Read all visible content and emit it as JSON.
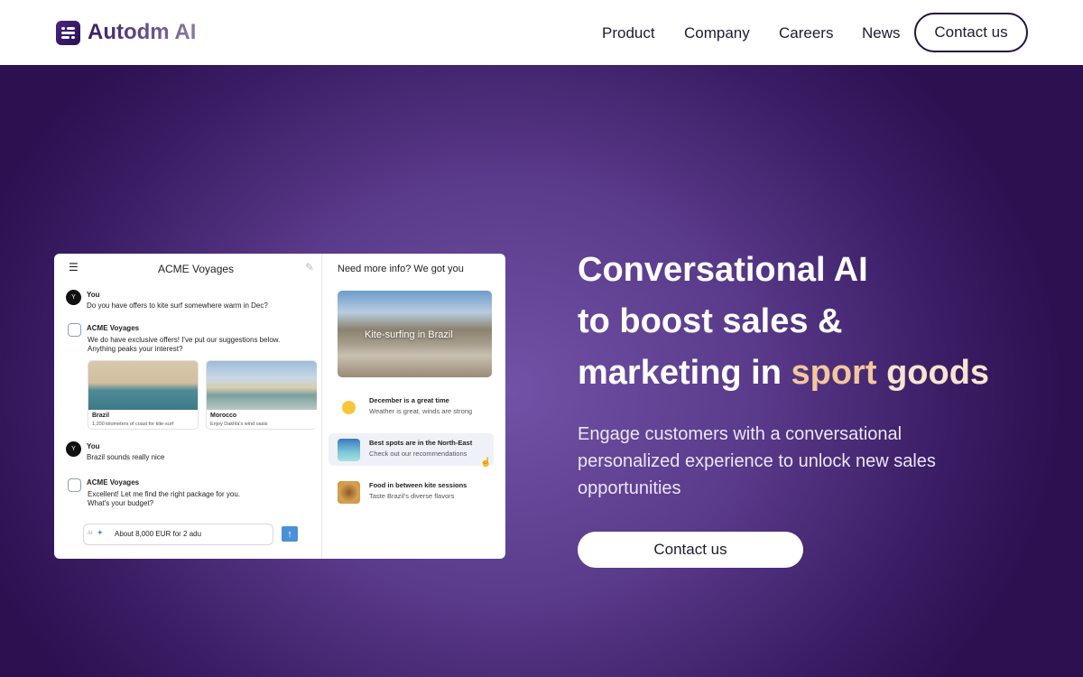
{
  "header": {
    "logo": "Autodm AI",
    "nav": [
      "Product",
      "Company",
      "Careers",
      "News"
    ],
    "contact": "Contact us"
  },
  "chat": {
    "title": "ACME Voyages",
    "messages": [
      {
        "sender": "You",
        "avatar": "Y",
        "text": "Do you have offers to kite surf somewhere warm in Dec?"
      },
      {
        "sender": "ACME Voyages",
        "lines": [
          "We do have exclusive offers! I've put our suggestions below.",
          "Anything peaks your interest?"
        ]
      },
      {
        "sender": "You",
        "avatar": "Y",
        "text": "Brazil sounds really nice"
      },
      {
        "sender": "ACME Voyages",
        "lines": [
          "Excellent! Let me find the right package for you.",
          "What's your budget?"
        ]
      }
    ],
    "offers": [
      {
        "title": "Brazil",
        "subtitle": "1,200 kilometers of coast for kite-surf"
      },
      {
        "title": "Morocco",
        "subtitle": "Enjoy Dakhla's wind oasis"
      }
    ],
    "input": {
      "prefix": "AI",
      "value": "About 8,000 EUR for 2 adu"
    }
  },
  "side": {
    "title": "Need more info? We got you",
    "banner": "Kite-surfing in Brazil",
    "items": [
      {
        "title": "December is a great time",
        "subtitle": "Weather is great, winds are strong"
      },
      {
        "title": "Best spots are in the North-East",
        "subtitle": "Check out our recommendations"
      },
      {
        "title": "Food in between kite sessions",
        "subtitle": "Taste Brazil's diverse flavors"
      }
    ]
  },
  "hero": {
    "line1": "Conversational AI",
    "line2": "to boost sales &",
    "line3": "marketing in ",
    "hl1": "sport",
    "hl2": "goods",
    "para": [
      "Engage customers with a conversational",
      "personalized experience to unlock new sales",
      "opportunities"
    ],
    "cta": "Contact us"
  },
  "colors": {
    "accent_sport": "#f3c79c",
    "accent_goods": "#f7e4cf",
    "brand": "#2c1050"
  }
}
